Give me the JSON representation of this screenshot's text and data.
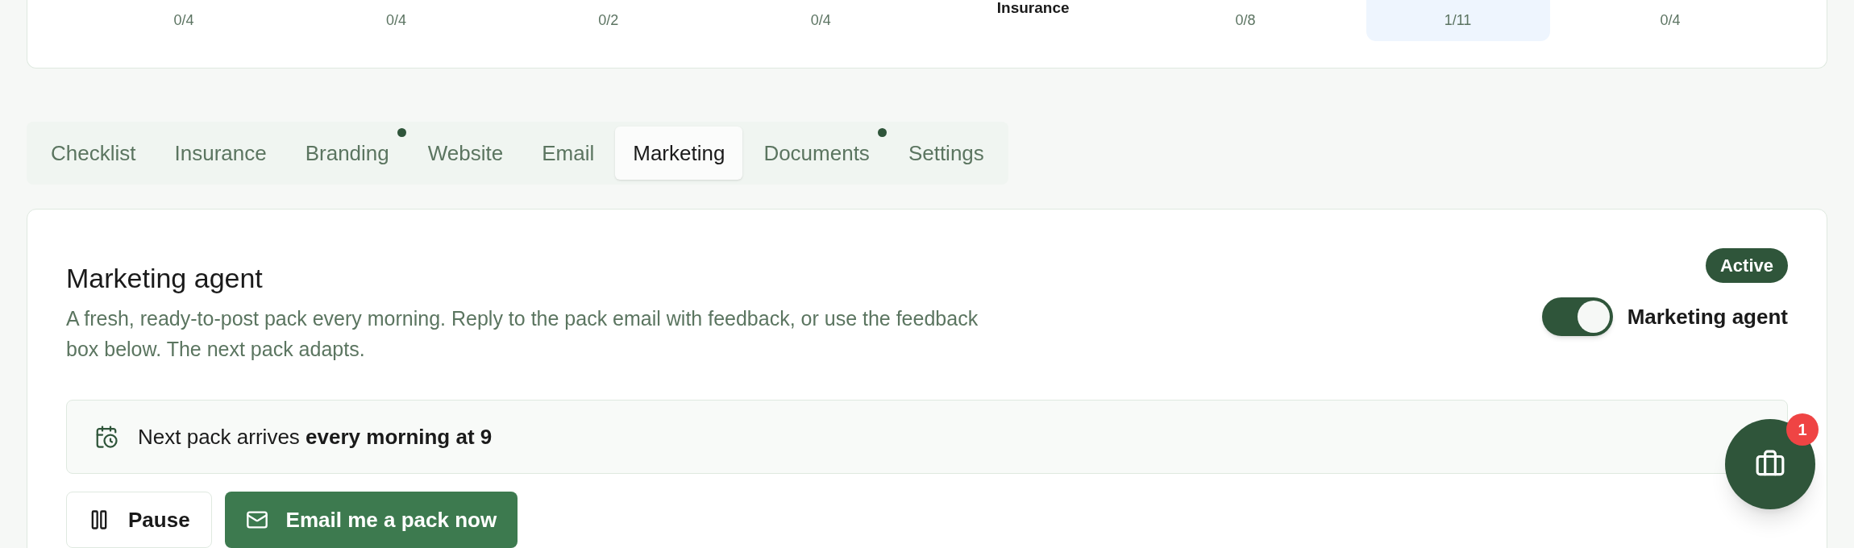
{
  "steps": [
    {
      "count": "0/4",
      "selected": false
    },
    {
      "count": "0/4",
      "selected": false
    },
    {
      "count": "0/2",
      "selected": false
    },
    {
      "count": "0/4",
      "selected": false
    },
    {
      "label": "Insurance",
      "selected": false
    },
    {
      "count": "0/8",
      "selected": false
    },
    {
      "count": "1/11",
      "selected": true
    },
    {
      "count": "0/4",
      "selected": false
    }
  ],
  "tabs": [
    {
      "label": "Checklist",
      "selected": false,
      "dot": false
    },
    {
      "label": "Insurance",
      "selected": false,
      "dot": false
    },
    {
      "label": "Branding",
      "selected": false,
      "dot": true
    },
    {
      "label": "Website",
      "selected": false,
      "dot": false
    },
    {
      "label": "Email",
      "selected": false,
      "dot": false
    },
    {
      "label": "Marketing",
      "selected": true,
      "dot": false
    },
    {
      "label": "Documents",
      "selected": false,
      "dot": true
    },
    {
      "label": "Settings",
      "selected": false,
      "dot": false
    }
  ],
  "agent": {
    "title": "Marketing agent",
    "description": "A fresh, ready-to-post pack every morning. Reply to the pack email with feedback, or use the feedback box below. The next pack adapts.",
    "status": "Active",
    "toggle": {
      "label": "Marketing agent",
      "on": true
    },
    "schedule": "Next pack arrives **every morning at 9**",
    "buttons": [
      {
        "label": "Pause",
        "kind": "secondary"
      },
      {
        "label": "Email me a pack now",
        "kind": "primary"
      }
    ]
  },
  "fab": {
    "badge": "1"
  }
}
